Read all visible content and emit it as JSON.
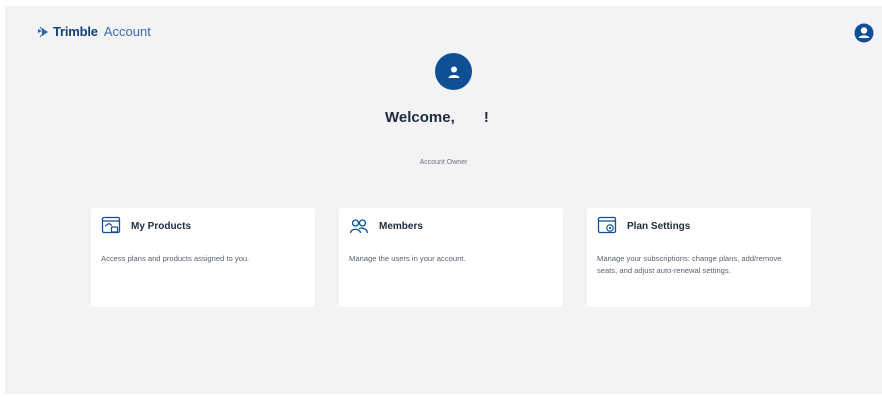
{
  "header": {
    "brand_name": "Trimble",
    "brand_product": "Account"
  },
  "welcome": {
    "greeting": "Welcome,       !",
    "role": "Account Owner"
  },
  "cards": [
    {
      "title": "My Products",
      "description": "Access plans and products assigned to you.",
      "icon": "products-icon"
    },
    {
      "title": "Members",
      "description": "Manage the users in your account.",
      "icon": "members-icon"
    },
    {
      "title": "Plan Settings",
      "description": "Manage your subscriptions: change plans, add/remove seats, and adjust auto-renewal settings.",
      "icon": "plan-settings-icon"
    }
  ],
  "colors": {
    "brand": "#0f5094",
    "background": "#f3f3f6",
    "card": "#ffffff"
  }
}
